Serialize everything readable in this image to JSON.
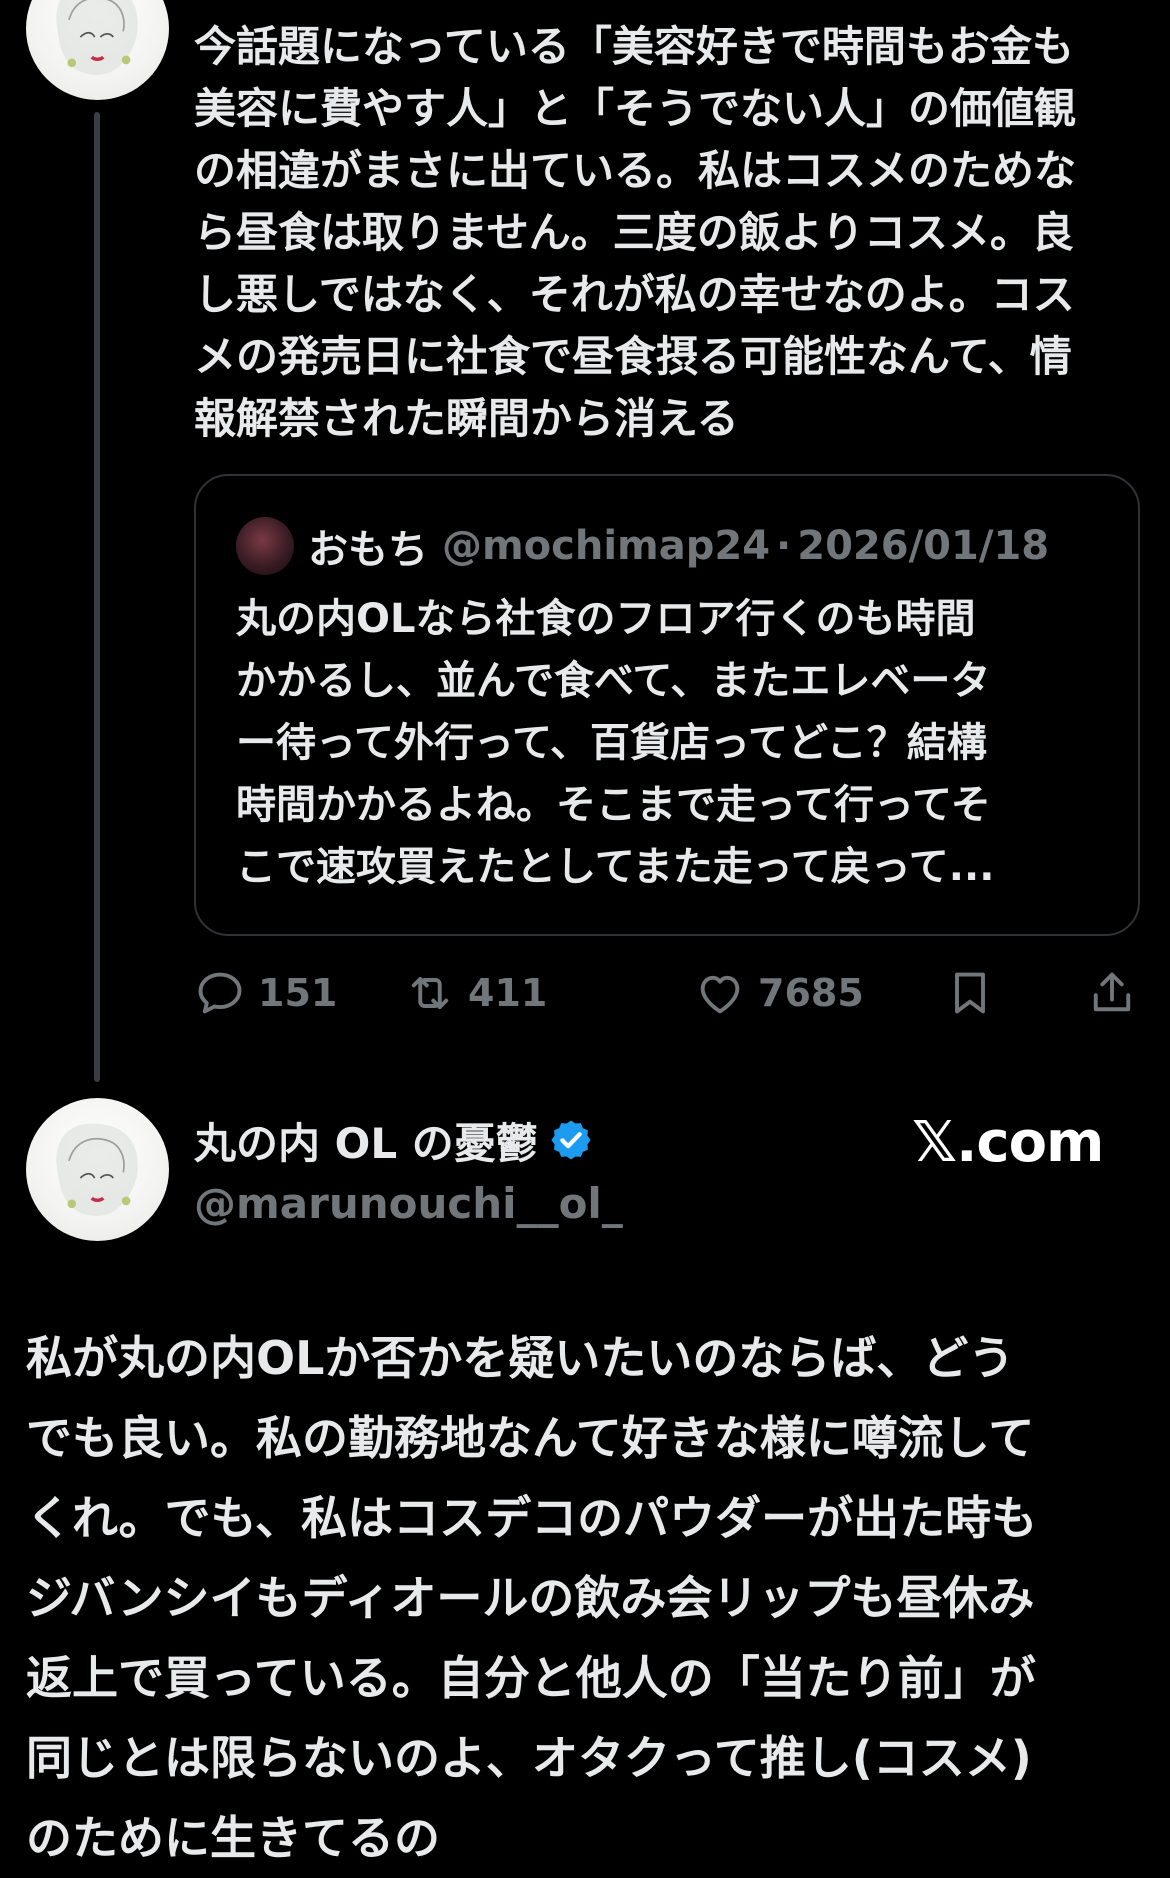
{
  "thread": {
    "tweet1": {
      "text": "今話題になっている「美容好きで時間もお金も\n美容に費やす人」と「そうでない人」の価値観\nの相違がまさに出ている。私はコスメのためな\nら昼食は取りません。三度の飯よりコスメ。良\nし悪しではなく、それが私の幸せなのよ。コス\nメの発売日に社食で昼食摂る可能性なんて、情\n報解禁された瞬間から消える"
    },
    "quote": {
      "name": "おもち",
      "handle": "@mochimap24",
      "separator": "·",
      "date": "2026/01/18",
      "text": "丸の内OLなら社食のフロア行くのも時間\nかかるし、並んで食べて、またエレベータ\nー待って外行って、百貨店ってどこ？結構\n時間かかるよね。そこまで走って行ってそ\nこで速攻買えたとしてまた走って戻って..."
    },
    "actions": {
      "reply_count": "151",
      "repost_count": "411",
      "like_count": "7685"
    },
    "tweet2": {
      "name": "丸の内 OL の憂鬱",
      "handle": "@marunouchi__ol_",
      "site": "𝕏.com",
      "text": "私が丸の内OLか否かを疑いたいのならば、どう\nでも良い。私の勤務地なんて好きな様に噂流して\nくれ。でも、私はコスデコのパウダーが出た時も\nジバンシイもディオールの飲み会リップも昼休み\n返上で買っている。自分と他人の「当たり前」が\n同じとは限らないのよ、オタクって推し(コスメ)\nのために生きてるの"
    }
  },
  "icons": {
    "reply": "speech-bubble-icon",
    "repost": "repost-arrows-icon",
    "like": "heart-icon",
    "bookmark": "bookmark-icon",
    "share": "share-upload-icon",
    "verified": "verified-badge-icon"
  },
  "colors": {
    "background": "#000000",
    "text": "#e7e9ea",
    "secondary": "#71767b",
    "border": "#2f3336",
    "verified": "#1d9bf0"
  }
}
